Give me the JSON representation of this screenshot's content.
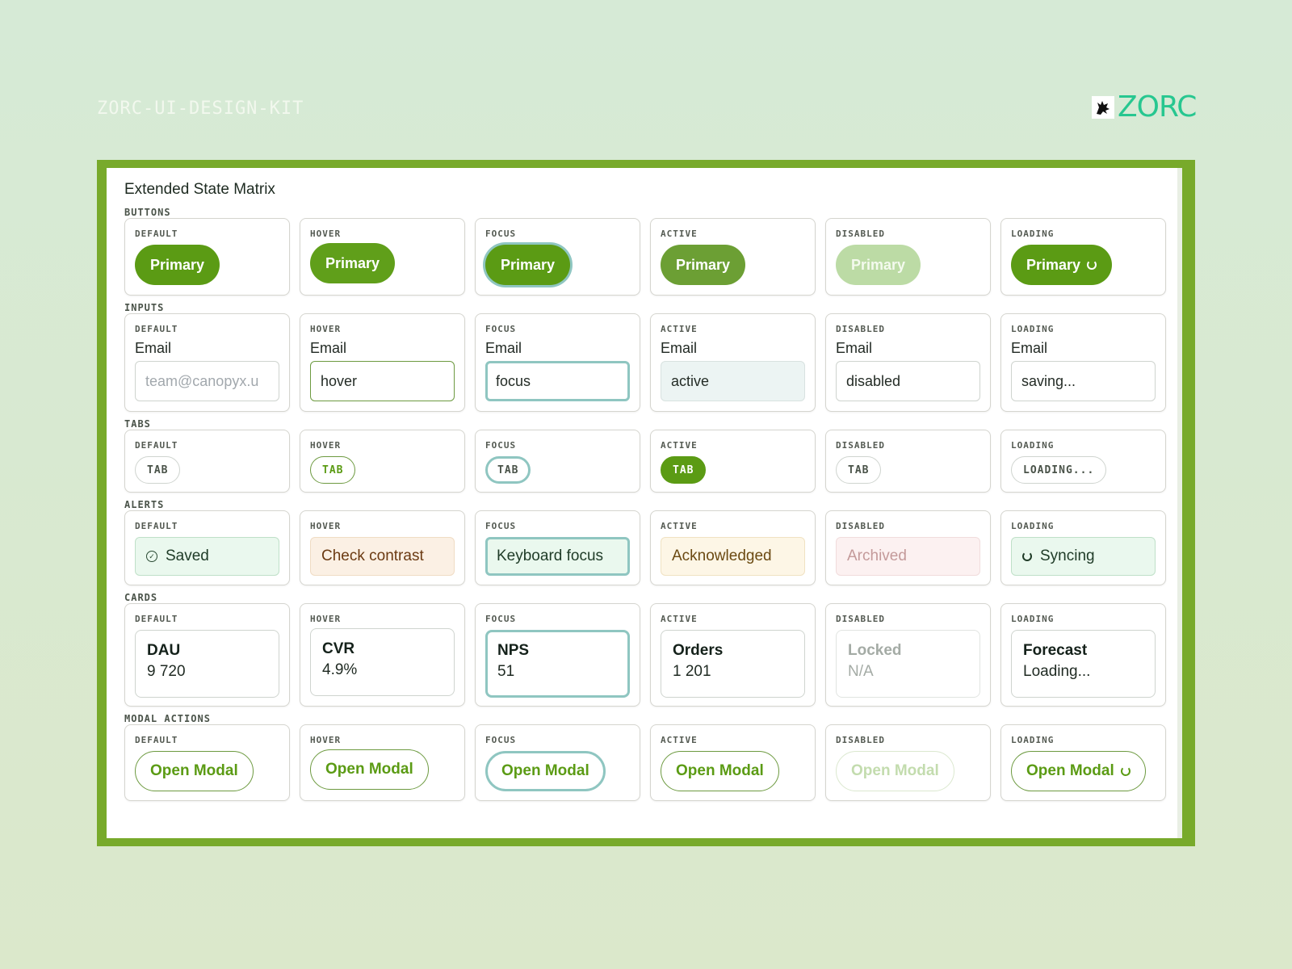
{
  "header": {
    "kit_title": "ZORC-UI-DESIGN-KIT",
    "brand_name": "ZORC"
  },
  "panel": {
    "title": "Extended State Matrix"
  },
  "states": [
    "DEFAULT",
    "HOVER",
    "FOCUS",
    "ACTIVE",
    "DISABLED",
    "LOADING"
  ],
  "sections": {
    "buttons": {
      "label": "BUTTONS",
      "labels": [
        "Primary",
        "Primary",
        "Primary",
        "Primary",
        "Primary",
        "Primary"
      ]
    },
    "inputs": {
      "label": "INPUTS",
      "field_label": "Email",
      "values": [
        "",
        "hover",
        "focus",
        "active",
        "disabled",
        "saving..."
      ],
      "placeholder": "team@canopyx.u"
    },
    "tabs": {
      "label": "TABS",
      "labels": [
        "TAB",
        "TAB",
        "TAB",
        "TAB",
        "TAB",
        "LOADING..."
      ]
    },
    "alerts": {
      "label": "ALERTS",
      "texts": [
        "Saved",
        "Check contrast",
        "Keyboard focus",
        "Acknowledged",
        "Archived",
        "Syncing"
      ]
    },
    "cards": {
      "label": "CARDS",
      "items": [
        {
          "title": "DAU",
          "value": "9 720"
        },
        {
          "title": "CVR",
          "value": "4.9%"
        },
        {
          "title": "NPS",
          "value": "51"
        },
        {
          "title": "Orders",
          "value": "1 201"
        },
        {
          "title": "Locked",
          "value": "N/A"
        },
        {
          "title": "Forecast",
          "value": "Loading..."
        }
      ]
    },
    "modal_actions": {
      "label": "MODAL ACTIONS",
      "labels": [
        "Open Modal",
        "Open Modal",
        "Open Modal",
        "Open Modal",
        "Open Modal",
        "Open Modal"
      ]
    }
  },
  "colors": {
    "accent": "#5b9b14",
    "frame": "#78aa2b",
    "focus_ring": "#8fc6c1",
    "brand": "#27c790"
  },
  "icons": {
    "brand_mark": "wolf-logo-icon",
    "alert_default": "check-circle-icon",
    "alert_loading": "spinner-icon",
    "button_loading": "spinner-icon"
  }
}
